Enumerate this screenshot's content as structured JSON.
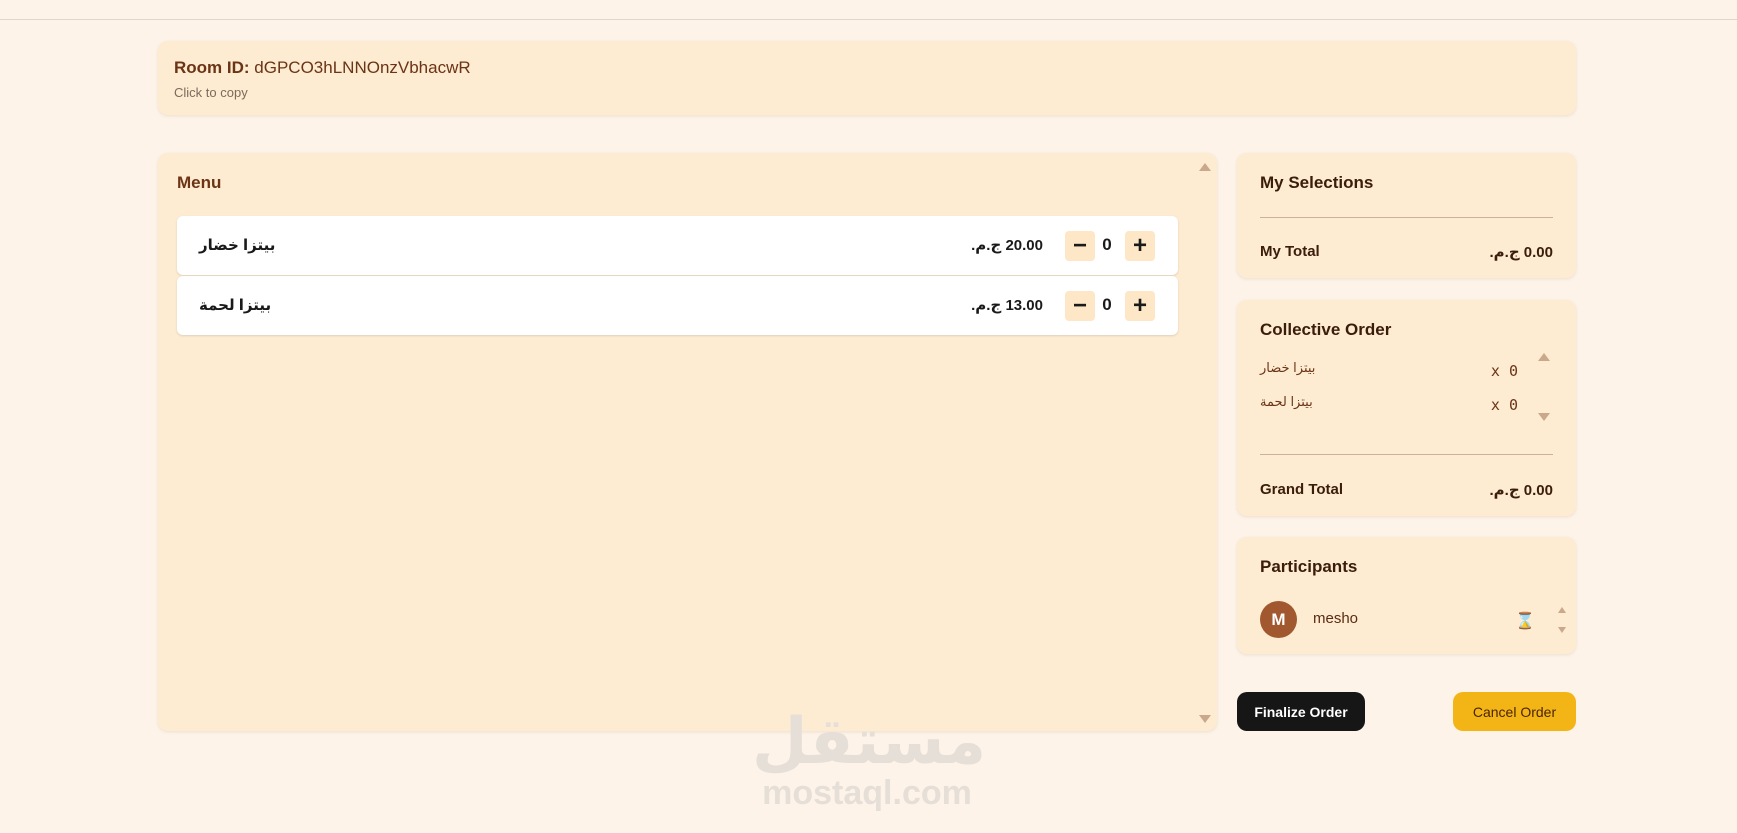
{
  "room": {
    "label": "Room ID:",
    "id": "dGPCO3hLNNOnzVbhacwR",
    "hint": "Click to copy"
  },
  "menu": {
    "title": "Menu",
    "items": [
      {
        "name": "بيتزا خضار",
        "price": "20.00 ج.م.",
        "qty": "0"
      },
      {
        "name": "بيتزا لحمة",
        "price": "13.00 ج.م.",
        "qty": "0"
      }
    ],
    "minus_icon": "minus-icon",
    "plus_icon": "plus-icon"
  },
  "selections": {
    "title": "My Selections",
    "total_label": "My Total",
    "total_value": "0.00 ج.م."
  },
  "collective": {
    "title": "Collective Order",
    "items": [
      {
        "name": "بيتزا خضار",
        "qty": "x 0"
      },
      {
        "name": "بيتزا لحمة",
        "qty": "x 0"
      }
    ],
    "grand_label": "Grand Total",
    "grand_value": "0.00 ج.م."
  },
  "participants": {
    "title": "Participants",
    "list": [
      {
        "initial": "M",
        "name": "mesho",
        "status_icon": "hourglass-icon",
        "status_glyph": "⌛"
      }
    ]
  },
  "actions": {
    "finalize": "Finalize Order",
    "cancel": "Cancel Order"
  },
  "watermark": {
    "arabic": "مستقل",
    "latin": "mostaql.com"
  },
  "colors": {
    "background": "#fdf3e8",
    "card": "#fdebd2",
    "accent_brown": "#6b3415",
    "avatar": "#a1582f",
    "finalize_bg": "#161616",
    "cancel_bg": "#f3b516"
  }
}
